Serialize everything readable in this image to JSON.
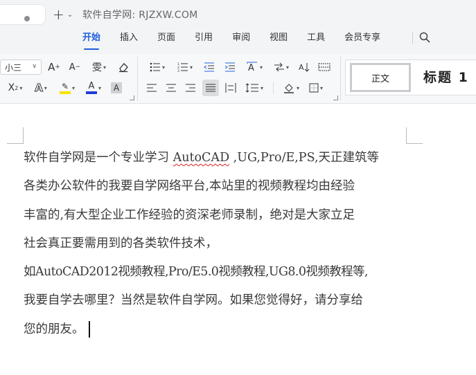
{
  "app": {
    "site_title": "软件自学网: RJZXW.COM"
  },
  "menu": {
    "items": [
      "开始",
      "插入",
      "页面",
      "引用",
      "审阅",
      "视图",
      "工具",
      "会员专享"
    ],
    "active": "开始"
  },
  "ribbon": {
    "font_size_value": "小三",
    "increase_font": "A",
    "decrease_font": "A",
    "phonetic": "雯",
    "superscript": "X",
    "font_color_glyph": "A",
    "highlight_glyph": "A",
    "char_shading_glyph": "A",
    "colors": {
      "highlight": "#f5e400",
      "font_color": "#1f3dd6",
      "char_shading_bg": "#d0d1d4"
    }
  },
  "styles": {
    "normal": "正文",
    "heading1": "标题 1"
  },
  "document": {
    "lines": [
      {
        "pre": "软件自学网是一个专业学习 ",
        "spell": "AutoCAD",
        "post": " ,UG,Pro/E,PS,天正建筑等"
      },
      {
        "pre": "各类办公软件的我要自学网络平台,本站里的视频教程均由经验",
        "spell": "",
        "post": ""
      },
      {
        "pre": "丰富的,有大型企业工作经验的资深老师录制，绝对是大家立足",
        "spell": "",
        "post": ""
      },
      {
        "pre": "社会真正要需用到的各类软件技术，",
        "spell": "",
        "post": ""
      },
      {
        "pre": "如AutoCAD2012视频教程,Pro/E5.0视频教程,UG8.0视频教程等,",
        "spell": "",
        "post": ""
      },
      {
        "pre": "我要自学去哪里？当然是软件自学网。如果您觉得好，请分享给",
        "spell": "",
        "post": ""
      },
      {
        "pre": "您的朋友。",
        "spell": "",
        "post": ""
      }
    ]
  },
  "icons": [
    "search-icon",
    "plus-icon",
    "chevron-down-icon",
    "eraser-icon",
    "bullet-list-icon",
    "numbered-list-icon",
    "decrease-indent-icon",
    "increase-indent-icon",
    "text-direction-icon",
    "sort-icon",
    "table-icon",
    "align-left-icon",
    "align-center-icon",
    "align-right-icon",
    "justify-icon",
    "distributed-icon",
    "line-spacing-icon",
    "shading-icon",
    "borders-icon"
  ]
}
